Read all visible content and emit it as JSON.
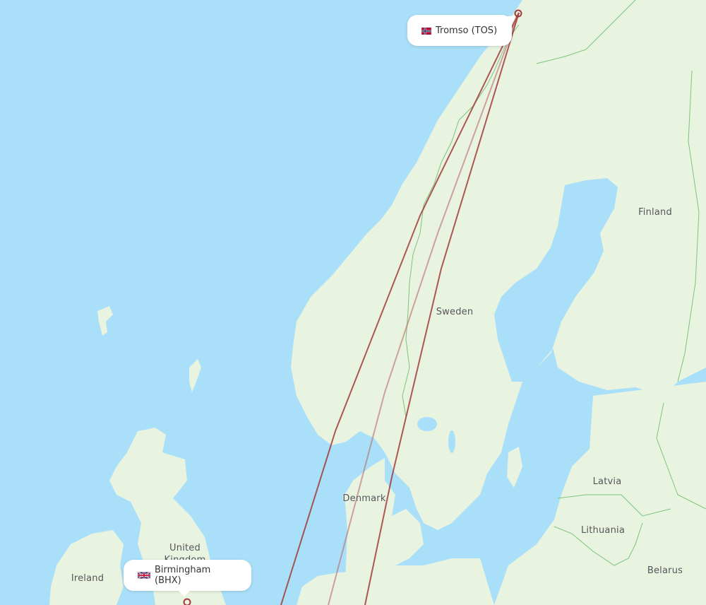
{
  "map": {
    "colors": {
      "water": "#aadff9",
      "land": "#e8f3e0",
      "border": "#7cc47c",
      "route": "#a33a3a",
      "route_faint": "#c08080",
      "label": "#555555"
    },
    "country_labels": [
      {
        "name": "Finland"
      },
      {
        "name": "Sweden"
      },
      {
        "name": "Denmark"
      },
      {
        "name": "Latvia"
      },
      {
        "name": "Lithuania"
      },
      {
        "name": "Belarus"
      },
      {
        "name": "Ireland"
      },
      {
        "name": "United"
      },
      {
        "name": "Kingdom"
      }
    ],
    "airports": {
      "origin": {
        "label": "Birmingham (BHX)",
        "city": "Birmingham",
        "code": "BHX",
        "flag": "gb-flag-icon"
      },
      "destination": {
        "label": "Tromso (TOS)",
        "city": "Tromso",
        "code": "TOS",
        "flag": "no-flag-icon"
      }
    },
    "routes": [
      {
        "name": "route-1",
        "style": "solid"
      },
      {
        "name": "route-2",
        "style": "faint"
      },
      {
        "name": "route-3",
        "style": "solid"
      }
    ]
  }
}
